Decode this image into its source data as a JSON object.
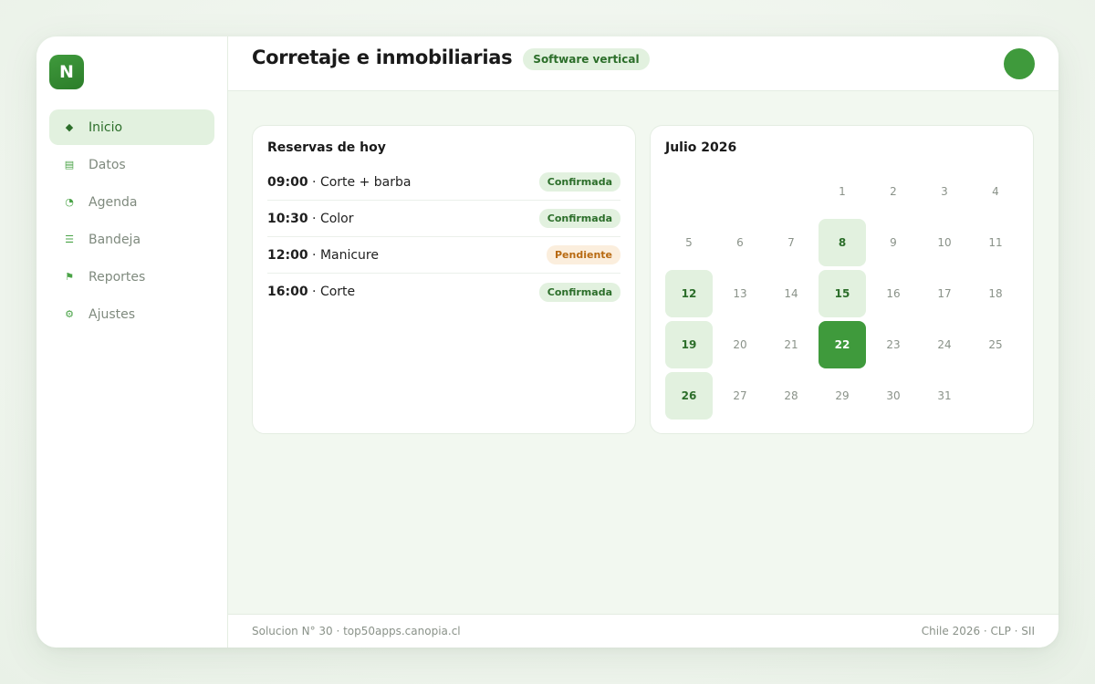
{
  "app": {
    "logo_letter": "N"
  },
  "sidebar": {
    "items": [
      {
        "label": "Inicio",
        "icon": "diamond-icon",
        "glyph": "◆",
        "active": true
      },
      {
        "label": "Datos",
        "icon": "table-icon",
        "glyph": "▤",
        "active": false
      },
      {
        "label": "Agenda",
        "icon": "clock-icon",
        "glyph": "◔",
        "active": false
      },
      {
        "label": "Bandeja",
        "icon": "list-icon",
        "glyph": "☰",
        "active": false
      },
      {
        "label": "Reportes",
        "icon": "flag-icon",
        "glyph": "⚑",
        "active": false
      },
      {
        "label": "Ajustes",
        "icon": "gear-icon",
        "glyph": "⚙",
        "active": false
      }
    ]
  },
  "header": {
    "title": "Corretaje e inmobiliarias",
    "badge": "Software vertical"
  },
  "reservas": {
    "title": "Reservas de hoy",
    "items": [
      {
        "time": "09:00",
        "service": "Corte + barba",
        "status": "Confirmada",
        "state": "ok"
      },
      {
        "time": "10:30",
        "service": "Color",
        "status": "Confirmada",
        "state": "ok"
      },
      {
        "time": "12:00",
        "service": "Manicure",
        "status": "Pendiente",
        "state": "pend"
      },
      {
        "time": "16:00",
        "service": "Corte",
        "status": "Confirmada",
        "state": "ok"
      }
    ]
  },
  "calendar": {
    "title": "Julio 2026",
    "leading_blanks": 3,
    "days": 31,
    "highlighted": [
      8,
      12,
      15,
      19,
      26
    ],
    "today": 22
  },
  "footer": {
    "left": "Solucion N° 30 · top50apps.canopia.cl",
    "right": "Chile 2026 · CLP · SII"
  },
  "colors": {
    "accent": "#3f9a3c",
    "accent_light": "#e2f1df",
    "pending": "#b86a12"
  }
}
